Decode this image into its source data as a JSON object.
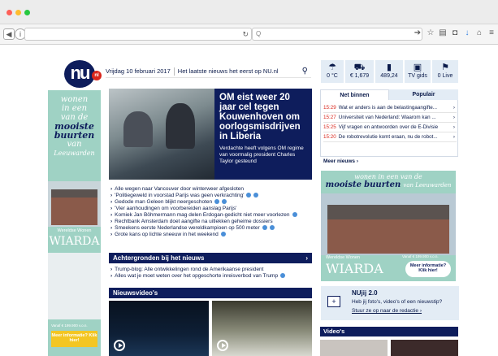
{
  "browser": {
    "traffic_lights": [
      "#fe5f57",
      "#febc2e",
      "#28c840"
    ],
    "search_placeholder": "Q"
  },
  "header": {
    "logo_text": "nu",
    "logo_badge": "nl",
    "date": "Vrijdag 10 februari 2017",
    "tagline": "Het laatste nieuws het eerst op NU.nl"
  },
  "services": [
    {
      "icon": "weather-icon",
      "glyph": "☂",
      "label": "0 °C"
    },
    {
      "icon": "car-icon",
      "glyph": "⛟",
      "label": "€ 1,679"
    },
    {
      "icon": "chart-icon",
      "glyph": "▮",
      "label": "489,24"
    },
    {
      "icon": "tv-icon",
      "glyph": "▣",
      "label": "TV gids"
    },
    {
      "icon": "runner-icon",
      "glyph": "⚑",
      "label": "0 Live"
    }
  ],
  "left_ad": {
    "line1": "wonen",
    "line2": "in een",
    "line3": "van de",
    "line4": "mooiste",
    "line5": "buurten",
    "line6": "van",
    "line7": "Leeuwarden",
    "brand_top": "Wereldse Wonen",
    "brand": "WIARDA",
    "price": "Vanaf € 199.900 v.o.n.",
    "cta": "Meer informatie? Klik hier!"
  },
  "hero": {
    "title": "OM eist weer 20 jaar cel tegen Kouwenhoven om oorlogsmisdrijven in Liberia",
    "subtitle": "Verdachte heeft volgens OM regime van voormalig president Charles Taylor gesteund"
  },
  "headlines": [
    {
      "text": "Alle wegen naar Vancouver door winterweer afgesloten",
      "video": false,
      "extra": false
    },
    {
      "text": "'Politiegeweld in voorstad Parijs was geen verkrachting'",
      "video": true,
      "extra": true
    },
    {
      "text": "Gedode man Geleen blijkt neergeschoten",
      "video": true,
      "extra": true
    },
    {
      "text": "'Vier aanhoudingen om voorbereiden aanslag Parijs'",
      "video": false,
      "extra": false
    },
    {
      "text": "Komiek Jan Böhmermann mag delen Erdogan-gedicht niet meer voorlezen",
      "video": true,
      "extra": false
    },
    {
      "text": "Rechtbank Amsterdam doet aangifte na uitlekken geheime dossiers",
      "video": false,
      "extra": false
    },
    {
      "text": "Smeekens eerste Nederlandse wereldkampioen op 500 meter",
      "video": true,
      "extra": true
    },
    {
      "text": "Grote kans op lichte sneeuw in het weekend",
      "video": true,
      "extra": false
    }
  ],
  "background_section": {
    "title": "Achtergronden bij het nieuws",
    "items": [
      {
        "text": "Trump-blog: Alle ontwikkelingen rond de Amerikaanse president",
        "video": false
      },
      {
        "text": "Alles wat je moet weten over het opgeschorte inreisverbod van Trump",
        "video": true
      }
    ]
  },
  "video_section": {
    "title": "Nieuwsvideo's"
  },
  "tabs": {
    "active": "Net binnen",
    "inactive": "Populair"
  },
  "news_list": [
    {
      "time": "15:29",
      "text": "Wat er anders is aan de belastingaangifte..."
    },
    {
      "time": "15:27",
      "text": "Universiteit van Nederland: Waarom kan ..."
    },
    {
      "time": "15:25",
      "text": "Vijf vragen en antwoorden over de E-Divisie"
    },
    {
      "time": "15:20",
      "text": "De robotrevolutie komt eraan, nu de robot..."
    }
  ],
  "more_news": "Meer nieuws",
  "right_ad": {
    "line1": "wonen in een van de",
    "line2": "mooiste",
    "line3": "buurten",
    "line4": "van Leeuwarden",
    "brand_top": "Wereldse Wonen",
    "brand": "WIARDA",
    "price": "Vanaf € 199.900 v.o.n.",
    "cta_line1": "Meer informatie?",
    "cta_line2": "Klik hier!"
  },
  "nujij": {
    "title": "NUjij 2.0",
    "text": "Heb jij foto's, video's of een nieuwstip?",
    "link": "Stuur ze op naar de redactie"
  },
  "videos_bar": {
    "title": "Video's"
  },
  "colors": {
    "navy": "#0e1d5c",
    "red": "#d9261c",
    "mint": "#9fd2c4",
    "yellow": "#f3c623"
  }
}
